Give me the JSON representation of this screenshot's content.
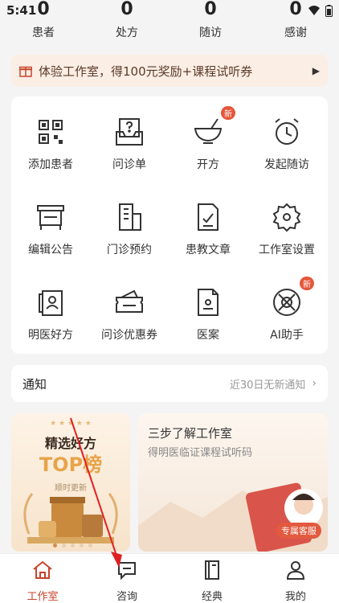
{
  "status_bar": {
    "time": "5:41"
  },
  "stats": [
    {
      "value": "0",
      "label": "患者"
    },
    {
      "value": "0",
      "label": "处方"
    },
    {
      "value": "0",
      "label": "随访"
    },
    {
      "value": "0",
      "label": "感谢"
    }
  ],
  "promo": {
    "text": "体验工作室，得100元奖励+课程试听券"
  },
  "grid": [
    {
      "label": "添加患者",
      "icon": "qr-scan-icon"
    },
    {
      "label": "问诊单",
      "icon": "inbox-question-icon"
    },
    {
      "label": "开方",
      "icon": "mortar-icon",
      "badge": "新"
    },
    {
      "label": "发起随访",
      "icon": "alarm-clock-icon"
    },
    {
      "label": "编辑公告",
      "icon": "notice-board-icon"
    },
    {
      "label": "门诊预约",
      "icon": "building-icon"
    },
    {
      "label": "患教文章",
      "icon": "document-check-icon"
    },
    {
      "label": "工作室设置",
      "icon": "gear-icon"
    },
    {
      "label": "明医好方",
      "icon": "doctor-card-icon"
    },
    {
      "label": "问诊优惠券",
      "icon": "coupon-icon"
    },
    {
      "label": "医案",
      "icon": "case-folder-icon"
    },
    {
      "label": "AI助手",
      "icon": "ai-orb-icon",
      "badge": "新"
    }
  ],
  "notice": {
    "title": "通知",
    "hint": "近30日无新通知"
  },
  "banner_left": {
    "title": "精选好方",
    "highlight": "TOP榜",
    "sub": "顺时更新"
  },
  "banner_right": {
    "title": "三步了解工作室",
    "sub": "得明医临证课程试听码",
    "badge": "专属客服"
  },
  "tabs": [
    {
      "label": "工作室",
      "active": true
    },
    {
      "label": "咨询",
      "active": false
    },
    {
      "label": "经典",
      "active": false
    },
    {
      "label": "我的",
      "active": false
    }
  ],
  "colors": {
    "accent": "#c8442c",
    "promo_bg": "#fbeee4",
    "badge": "#e5563a"
  }
}
